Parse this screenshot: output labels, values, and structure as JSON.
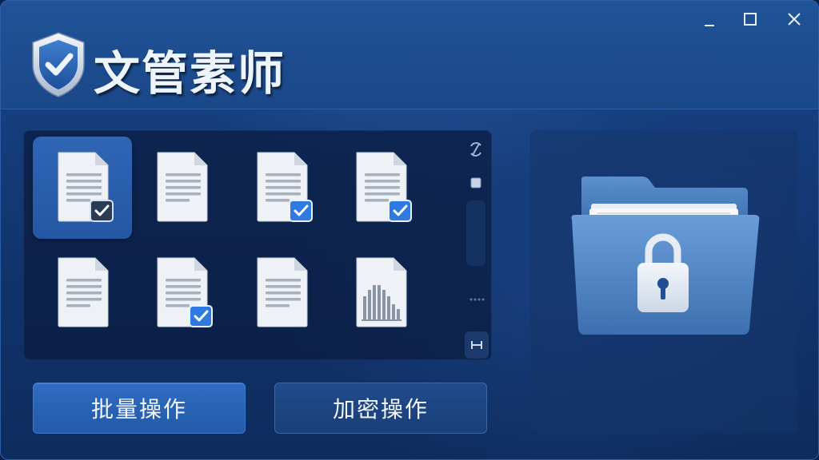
{
  "app": {
    "title": "文管素师",
    "logo_icon": "shield-check-icon"
  },
  "window_controls": {
    "minimize_icon": "minimize-icon",
    "maximize_icon": "maximize-icon",
    "close_icon": "close-icon"
  },
  "files": [
    {
      "icon": "document-icon",
      "checked": true,
      "selected": true
    },
    {
      "icon": "document-icon",
      "checked": false,
      "selected": false
    },
    {
      "icon": "document-icon",
      "checked": true,
      "selected": false
    },
    {
      "icon": "document-icon",
      "checked": true,
      "selected": false
    },
    {
      "icon": "document-icon",
      "checked": false,
      "selected": false
    },
    {
      "icon": "document-icon",
      "checked": true,
      "selected": false
    },
    {
      "icon": "document-icon",
      "checked": false,
      "selected": false
    },
    {
      "icon": "spreadsheet-document-icon",
      "checked": false,
      "selected": false
    }
  ],
  "side_strip": {
    "top_icon": "sync-icon",
    "second_icon": "square-icon",
    "dots_icon": "more-dots-icon",
    "bottom_icon": "h-icon"
  },
  "preview": {
    "icon": "locked-folder-icon"
  },
  "buttons": {
    "batch_label": "批量操作",
    "encrypt_label": "加密操作"
  },
  "colors": {
    "accent": "#2f6cc2",
    "background": "#11336a",
    "check_blue": "#2f7ae0"
  }
}
